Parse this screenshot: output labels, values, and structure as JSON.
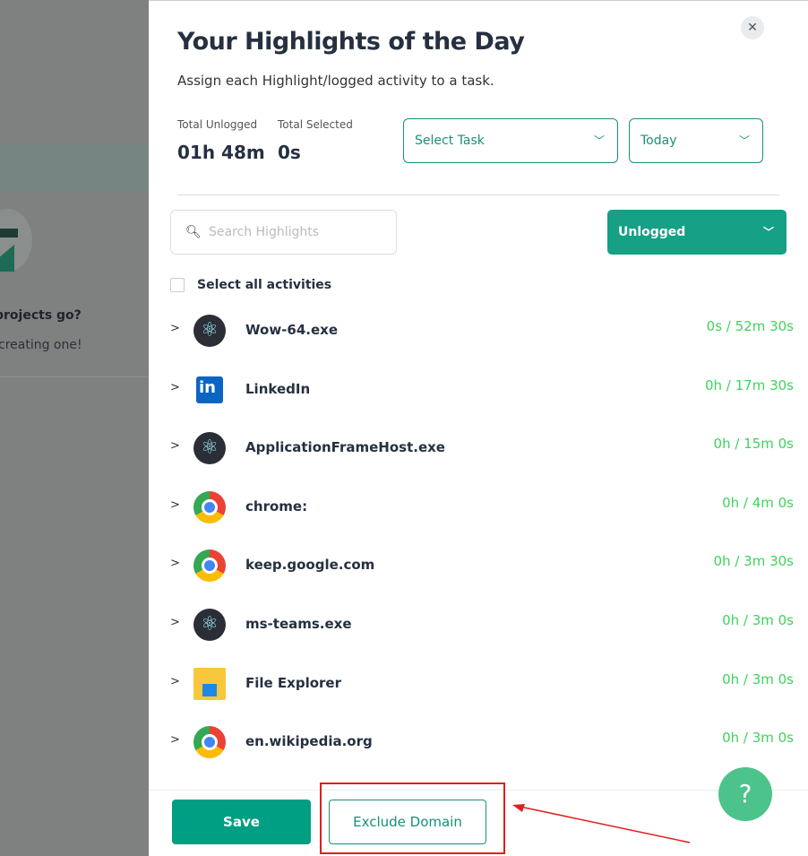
{
  "background": {
    "heading": "projects go?",
    "text": "creating one!"
  },
  "modal": {
    "title": "Your Highlights of the Day",
    "subtitle": "Assign each Highlight/logged activity to a task.",
    "stats": [
      {
        "label": "Total Unlogged",
        "value": "01h 48m"
      },
      {
        "label": "Total Selected",
        "value": "0s"
      }
    ],
    "task_select": "Select Task",
    "date_select": "Today",
    "search_placeholder": "Search Highlights",
    "filter": "Unlogged",
    "select_all": "Select all activities",
    "activities": [
      {
        "name": "Wow-64.exe",
        "time": "0s / 52m 30s",
        "icon": "electron-icon"
      },
      {
        "name": "LinkedIn",
        "time": "0h / 17m 30s",
        "icon": "linkedin-icon"
      },
      {
        "name": "ApplicationFrameHost.exe",
        "time": "0h / 15m 0s",
        "icon": "electron-icon"
      },
      {
        "name": "chrome:",
        "time": "0h / 4m 0s",
        "icon": "chrome-icon"
      },
      {
        "name": "keep.google.com",
        "time": "0h / 3m 30s",
        "icon": "chrome-icon"
      },
      {
        "name": "ms-teams.exe",
        "time": "0h / 3m 0s",
        "icon": "electron-icon"
      },
      {
        "name": "File Explorer",
        "time": "0h / 3m 0s",
        "icon": "file-explorer-icon"
      },
      {
        "name": "en.wikipedia.org",
        "time": "0h / 3m 0s",
        "icon": "chrome-icon"
      }
    ],
    "save": "Save",
    "exclude": "Exclude Domain",
    "help": "?"
  },
  "colors": {
    "accent": "#16a085",
    "time": "#3fd35c",
    "annotation": "#e01e1e"
  }
}
